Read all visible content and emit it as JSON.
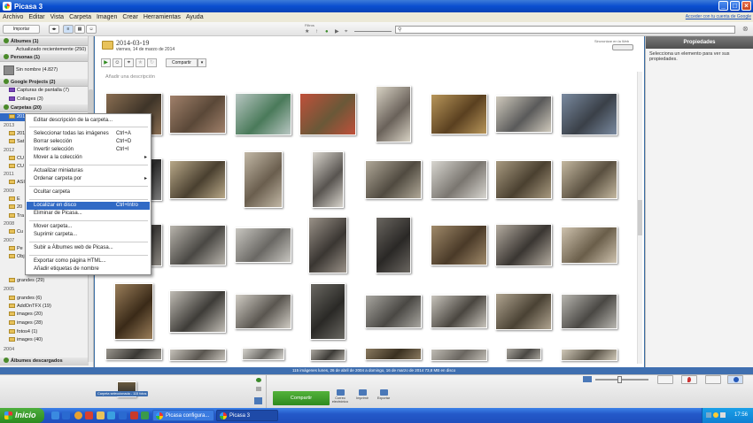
{
  "window": {
    "title": "Picasa 3"
  },
  "menu": {
    "items": [
      "Archivo",
      "Editar",
      "Vista",
      "Carpeta",
      "Imagen",
      "Crear",
      "Herramientas",
      "Ayuda"
    ],
    "signin": "Acceder con tu cuenta de Google"
  },
  "toolbar": {
    "import_label": "Importar",
    "filters_label": "Filtros"
  },
  "left_panel": {
    "albums": "Álbumes (1)",
    "albums_updated": "Actualizado recientemente (250)",
    "people": "Personas (1)",
    "people_unnamed": "Sin nombre (4.827)",
    "projects": "Google Projects (2)",
    "projects_captures": "Capturas de pantalla (7)",
    "projects_collages": "Collages (3)",
    "folders": "Carpetas (20)",
    "folder_selected": "2014-03-19",
    "year_2013": "2013",
    "f_201": "201",
    "f_sat": "Sat",
    "year_2012": "2012",
    "f_cu1": "CU",
    "f_cu2": "CU",
    "year_2011": "2011",
    "f_asi": "ASI",
    "year_2009": "2009",
    "f_e": "E",
    "f_20": "20",
    "f_tra": "Tra",
    "year_2008": "2008",
    "f_cu3": "Cu",
    "year_2007": "2007",
    "f_pe": "Pe",
    "f_obj": "Obj",
    "f_grandes29": "grandes (29)",
    "year_2005": "2005",
    "f_grandes6": "grandes (6)",
    "f_addon": "AddOnTFX (19)",
    "f_images20": "images (20)",
    "f_images28": "images (28)",
    "f_fotos": "fotos4 (1)",
    "f_images40": "images (40)",
    "year_2004": "2004",
    "downloaded": "Álbumes descargados"
  },
  "context_menu": {
    "edit_desc": "Editar descripción de la carpeta...",
    "select_all": "Seleccionar todas las imágenes",
    "select_all_sc": "Ctrl+A",
    "clear_sel": "Borrar selección",
    "clear_sel_sc": "Ctrl+D",
    "invert_sel": "Invertir selección",
    "invert_sel_sc": "Ctrl+I",
    "move_collection": "Mover a la colección",
    "update_thumbs": "Actualizar miniaturas",
    "sort_by": "Ordenar carpeta por",
    "hide_folder": "Ocultar carpeta",
    "locate_disk": "Localizar en disco",
    "locate_disk_sc": "Ctrl+Intro",
    "remove_picasa": "Eliminar de Picasa...",
    "move_folder": "Mover carpeta...",
    "delete_folder": "Suprimir carpeta...",
    "upload_web": "Subir a Álbumes web de Picasa...",
    "export_html": "Exportar como página HTML...",
    "add_tags": "Añadir etiquetas de nombre"
  },
  "main": {
    "folder_title": "2014-03-19",
    "folder_date": "viernes, 14 de marzo de 2014",
    "sync_label": "Sincronizar en la Web",
    "share_label": "Compartir",
    "add_description": "Añadir una descripción"
  },
  "right_panel": {
    "title": "Propiedades",
    "text": "Selecciona un elemento para ver sus propiedades."
  },
  "status": {
    "text": "115 imágenes   lunes, 26 de abril de 2004 a domingo, 16 de marzo de 2014   73,8 MB en disco"
  },
  "tray": {
    "holding_label": "Carpeta seleccionada - 115 fotos",
    "share": "Compartir",
    "email": "Correo electrónico",
    "print": "Imprimir",
    "export": "Exportar"
  },
  "taskbar": {
    "start": "Inicio",
    "task1": "Picasa configura...",
    "task2": "Picasa 3",
    "clock": "17:56"
  },
  "colors": {
    "accent": "#316ac5",
    "status_bar": "#3f6fb0",
    "share_green": "#2e8a1e"
  },
  "photos": [
    {
      "c1": "#8a6e52",
      "c2": "#3e3428"
    },
    {
      "c1": "#a0806a",
      "c2": "#5a4838"
    },
    {
      "c1": "#b8c6c2",
      "c2": "#4a7a5a"
    },
    {
      "c1": "#c0503a",
      "c2": "#6a5838"
    },
    {
      "c1": "#d8d2c4",
      "c2": "#6a625a"
    },
    {
      "c1": "#b8965a",
      "c2": "#5a4020"
    },
    {
      "c1": "#cfc9bc",
      "c2": "#5a5a5a"
    },
    {
      "c1": "#7a8aa0",
      "c2": "#3a4048"
    },
    {
      "c1": "#7a7a7a",
      "c2": "#2a2a2a"
    },
    {
      "c1": "#b8a888",
      "c2": "#4a4030"
    },
    {
      "c1": "#c2b8a6",
      "c2": "#6a5e4e"
    },
    {
      "c1": "#d8d4cc",
      "c2": "#585450"
    },
    {
      "c1": "#b0a898",
      "c2": "#504a40"
    },
    {
      "c1": "#d8d6d0",
      "c2": "#7a7670"
    },
    {
      "c1": "#a89a80",
      "c2": "#4a4030"
    },
    {
      "c1": "#c4b8a0",
      "c2": "#5a5040"
    },
    {
      "c1": "#8a8680",
      "c2": "#3a3836"
    },
    {
      "c1": "#b8b4ac",
      "c2": "#4a4844"
    },
    {
      "c1": "#c8c6c0",
      "c2": "#6a6864"
    },
    {
      "c1": "#9a9288",
      "c2": "#3a3632"
    },
    {
      "c1": "#6a6660",
      "c2": "#2a2826"
    },
    {
      "c1": "#a08a6a",
      "c2": "#4a3a28"
    },
    {
      "c1": "#b4aca0",
      "c2": "#3a3632"
    },
    {
      "c1": "#cec2ae",
      "c2": "#6a5e4a"
    },
    {
      "c1": "#9a7e5a",
      "c2": "#3a2a18"
    },
    {
      "c1": "#c0bcb4",
      "c2": "#3e3c38"
    },
    {
      "c1": "#d0ccc4",
      "c2": "#5a5650"
    },
    {
      "c1": "#6a6862",
      "c2": "#2a2926"
    },
    {
      "c1": "#a8a6a0",
      "c2": "#4a4844"
    },
    {
      "c1": "#c8c4bc",
      "c2": "#4a4640"
    },
    {
      "c1": "#b0a490",
      "c2": "#4a4234"
    },
    {
      "c1": "#b8b6b0",
      "c2": "#4a4844"
    },
    {
      "c1": "#9a968e",
      "c2": "#3a3834"
    },
    {
      "c1": "#c6c2ba",
      "c2": "#5a5650"
    },
    {
      "c1": "#d6d4ce",
      "c2": "#6a6864"
    },
    {
      "c1": "#aca8a0",
      "c2": "#3e3c38"
    },
    {
      "c1": "#8a7a60",
      "c2": "#3a3020"
    },
    {
      "c1": "#c0bcb4",
      "c2": "#6a6660"
    },
    {
      "c1": "#a8a49c",
      "c2": "#4a4844"
    },
    {
      "c1": "#d0c8b8",
      "c2": "#5a5448"
    }
  ]
}
